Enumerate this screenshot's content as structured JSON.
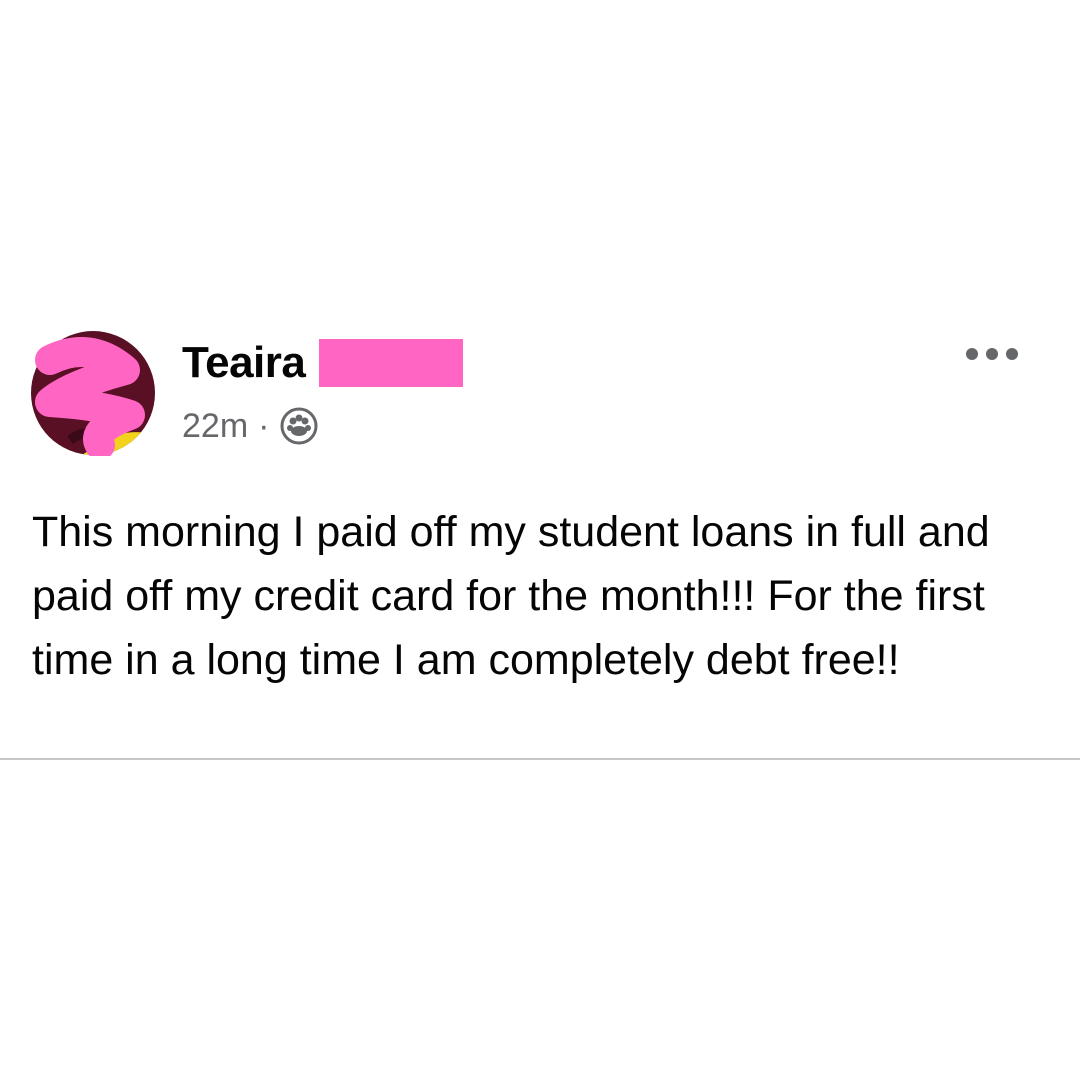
{
  "post": {
    "author": {
      "name": "Teaira",
      "name_redacted": true,
      "avatar_redacted": true
    },
    "time": "22m",
    "separator": "·",
    "audience_icon": "friends-icon",
    "more_icon": "more-horizontal-icon",
    "text": "This morning I paid off my student loans in full and paid off my credit card for the month!!! For the first time in a long time I am completely debt free!!"
  },
  "colors": {
    "redaction_pink": "#ff66c4",
    "text_primary": "#050505",
    "text_secondary": "#65676b",
    "divider": "#c8c8c8"
  }
}
